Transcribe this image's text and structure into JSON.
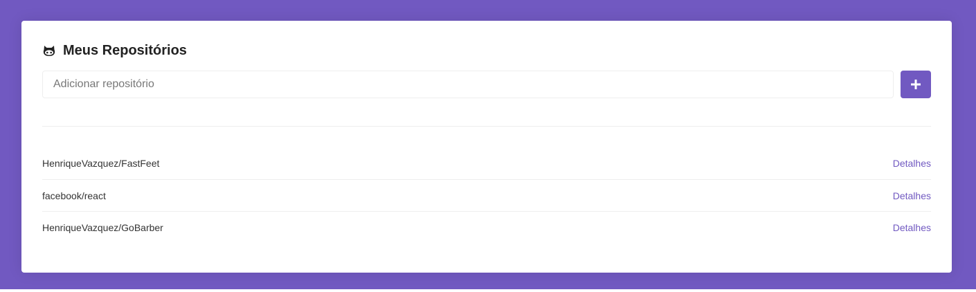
{
  "colors": {
    "accent": "#7159c1",
    "background": "#7159c1",
    "card": "#ffffff",
    "text": "#222222",
    "divider": "#eeeeee"
  },
  "header": {
    "icon": "github-icon",
    "title": "Meus Repositórios"
  },
  "form": {
    "placeholder": "Adicionar repositório",
    "value": "",
    "submit_icon": "plus-icon"
  },
  "repositories": [
    {
      "name": "HenriqueVazquez/FastFeet",
      "link_label": "Detalhes"
    },
    {
      "name": "facebook/react",
      "link_label": "Detalhes"
    },
    {
      "name": "HenriqueVazquez/GoBarber",
      "link_label": "Detalhes"
    }
  ]
}
